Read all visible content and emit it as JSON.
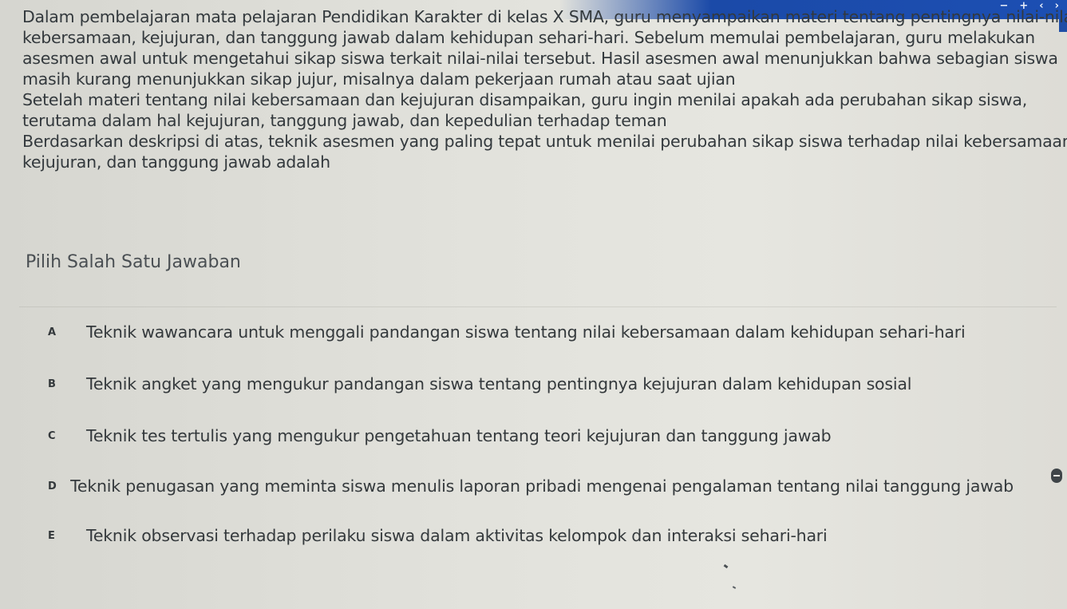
{
  "window": {
    "controls": [
      "−",
      "+",
      "‹",
      "›"
    ]
  },
  "question": {
    "lines": [
      "Dalam pembelajaran mata pelajaran Pendidikan Karakter di kelas X SMA, guru menyampaikan materi tentang pentingnya nilai-nilai",
      "kebersamaan, kejujuran, dan tanggung jawab dalam kehidupan sehari-hari. Sebelum memulai pembelajaran, guru melakukan",
      "asesmen awal untuk mengetahui sikap siswa terkait nilai-nilai tersebut. Hasil asesmen awal menunjukkan bahwa sebagian siswa",
      "masih kurang menunjukkan sikap jujur, misalnya dalam pekerjaan rumah atau saat ujian",
      "Setelah materi tentang nilai kebersamaan dan kejujuran disampaikan, guru ingin menilai apakah ada perubahan sikap siswa,",
      "terutama dalam hal kejujuran, tanggung jawab, dan kepedulian terhadap teman",
      "Berdasarkan deskripsi di atas, teknik asesmen yang paling tepat untuk menilai perubahan sikap siswa terhadap nilai kebersamaan,",
      "kejujuran, dan tanggung jawab adalah"
    ]
  },
  "instruction": "Pilih Salah Satu Jawaban",
  "options": [
    {
      "letter": "A",
      "text": "Teknik wawancara untuk menggali pandangan siswa tentang nilai kebersamaan dalam kehidupan sehari-hari"
    },
    {
      "letter": "B",
      "text": "Teknik angket yang mengukur pandangan siswa tentang pentingnya kejujuran dalam kehidupan sosial"
    },
    {
      "letter": "C",
      "text": "Teknik tes tertulis yang mengukur pengetahuan tentang teori kejujuran dan tanggung jawab"
    },
    {
      "letter": "D",
      "text": "Teknik penugasan yang meminta siswa menulis laporan pribadi mengenai pengalaman tentang nilai tanggung jawab"
    },
    {
      "letter": "E",
      "text": "Teknik observasi terhadap perilaku siswa dalam aktivitas kelompok dan interaksi sehari-hari"
    }
  ]
}
